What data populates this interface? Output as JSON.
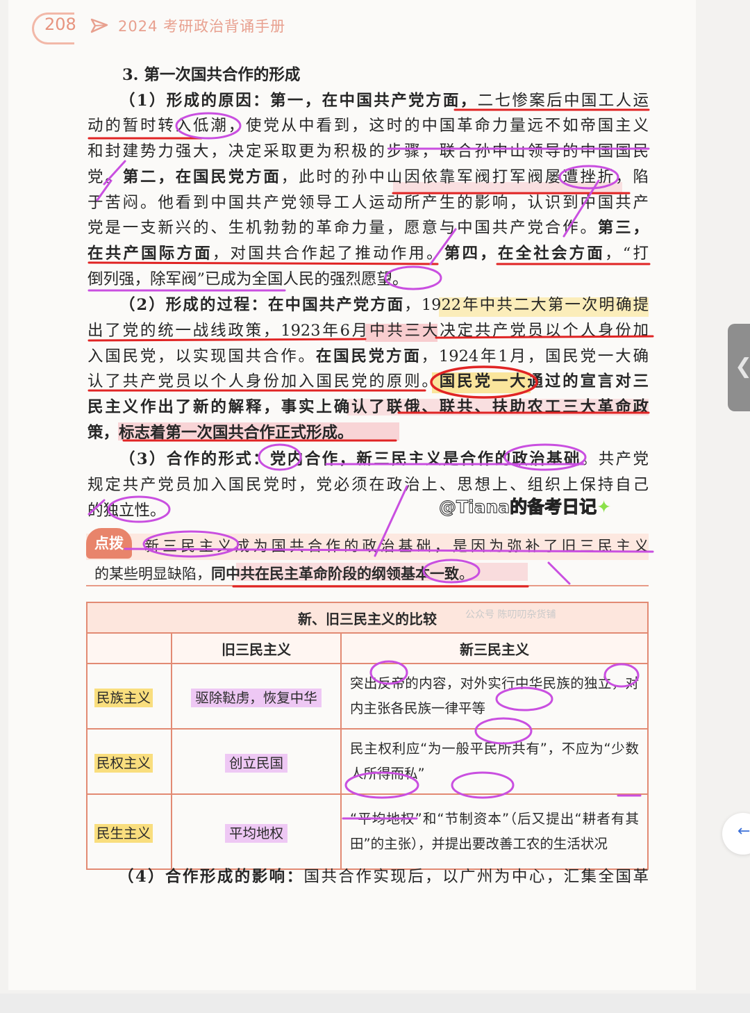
{
  "header": {
    "page_number": "208",
    "book_title": "2024 考研政治背诵手册"
  },
  "section": {
    "title": "3. 第一次国共合作的形成",
    "lines": [
      [
        "（1）形成的原因：第一，在中国共产党方面，",
        "二七惨案后中国工人运"
      ],
      [
        "动的暂时转入低潮，使党从中看到，这时的中国革命力量远不如帝国主义"
      ],
      [
        "和封建势力强大，决定采取更为积极的步骤，联合孙中山领导的中国国民"
      ],
      [
        "党。",
        "第二，在国民党方面",
        "，此时的孙中山因依靠军阀打军阀屡遭挫折，陷"
      ],
      [
        "于苦闷。他看到中国共产党领导工人运动所产生的影响，认识到中国共产"
      ],
      [
        "党是一支新兴的、生机勃勃的革命力量，愿意与中国共产党合作。",
        "第三，"
      ],
      [
        "在共产国际方面",
        "，对国共合作起了推动作用。",
        "第四，在全社会方面",
        "，“打"
      ],
      [
        "倒列强，除军阀”已成为全国人民的强烈愿望。"
      ],
      [
        "（2）形成的过程：在中国共产党方面",
        "，1922年中共二大第一次明确提"
      ],
      [
        "出了党的统一战线政策，1923年6月中共三大决定共产党员以个人身份加"
      ],
      [
        "入国民党，以实现国共合作。",
        "在国民党方面",
        "，1924年1月，国民党一大确"
      ],
      [
        "认了共产党员以个人身份加入国民党的原则。",
        "国民党一大通过的宣言对三"
      ],
      [
        "民主义作出了新的解释，事实上确认了联俄、联共、扶助农工三大革命政"
      ],
      [
        "策，标志着第一次国共合作正式形成。"
      ],
      [
        "（3）合作的形式：党内合作，新三民主义是合作的政治基础",
        "。共产党"
      ],
      [
        "规定共产党员加入国民党时，党必须在政治上、思想上、组织上保持自己"
      ],
      [
        "的独立性。"
      ]
    ],
    "bold_flags": [
      [
        true,
        false
      ],
      [
        false
      ],
      [
        false
      ],
      [
        false,
        true,
        false
      ],
      [
        false
      ],
      [
        false,
        true
      ],
      [
        true,
        false,
        true,
        false
      ],
      [
        false
      ],
      [
        true,
        false
      ],
      [
        false
      ],
      [
        false,
        true,
        false
      ],
      [
        false,
        true
      ],
      [
        true
      ],
      [
        true
      ],
      [
        true,
        false
      ],
      [
        false
      ],
      [
        false
      ]
    ]
  },
  "tip": {
    "badge": "点拨",
    "line1": "新三民主义成为国共合作的政治基础，是因为弥补了旧三民主义",
    "line2a": "的某些明显缺陷，",
    "line2b": "同中共在民主革命阶段的纲领基本一致",
    "line2c": "。"
  },
  "table": {
    "caption": "新、旧三民主义的比较",
    "watermark": "公众号 陈叨叨杂货铺",
    "headers": [
      "",
      "旧三民主义",
      "新三民主义"
    ],
    "rows": [
      {
        "name": "民族主义",
        "old": "驱除鞑虏，恢复中华",
        "new": "突出反帝的内容，对外实行中华民族的独立，对内主张各民族一律平等"
      },
      {
        "name": "民权主义",
        "old": "创立民国",
        "new": "民主权利应“为一般平民所共有”，不应为“少数人所得而私”"
      },
      {
        "name": "民生主义",
        "old": "平均地权",
        "new": "“平均地权”和“节制资本”（后又提出“耕者有其田”的主张），并提出要改善工农的生活状况"
      }
    ]
  },
  "bottom": {
    "prefix": "（4）合作形成的影响：",
    "text": "国共合作实现后，以广州为中心，汇集全国革"
  },
  "credit": {
    "text": "@Tiana的备考日记",
    "star": "✦"
  },
  "ui": {
    "side_handle_glyph": "❮",
    "back_glyph": "←"
  },
  "colors": {
    "accent": "#e28a73",
    "red_ink": "#e02424",
    "purple_ink": "#c94fe0",
    "yellow_highlight": "#f9de7e",
    "pink_highlight": "#f7c3c7"
  }
}
